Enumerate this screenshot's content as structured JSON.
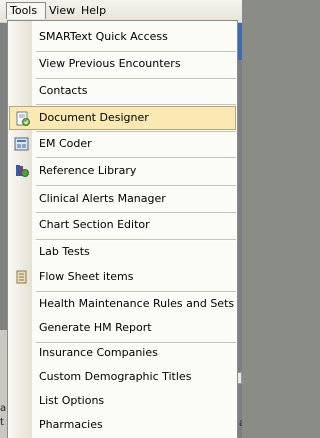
{
  "menubar": {
    "tools_label": "Tools",
    "view_label": "View",
    "help_label": "Help"
  },
  "background": {
    "left_text_1": "ab",
    "left_text_2": "t",
    "right_text": "a"
  },
  "tools_menu": {
    "items": [
      {
        "label": "SMARText Quick Access",
        "icon": ""
      },
      {
        "label": "View Previous Encounters",
        "icon": ""
      },
      {
        "label": "Contacts",
        "icon": ""
      },
      {
        "label": "Document Designer",
        "icon": "document-designer-icon",
        "highlighted": true
      },
      {
        "label": "EM Coder",
        "icon": "em-coder-icon"
      },
      {
        "label": "Reference Library",
        "icon": "reference-library-icon"
      },
      {
        "label": "Clinical Alerts Manager",
        "icon": ""
      },
      {
        "label": "Chart Section Editor",
        "icon": ""
      },
      {
        "label": "Lab Tests",
        "icon": ""
      },
      {
        "label": "Flow Sheet items",
        "icon": "flow-sheet-icon"
      },
      {
        "label": "Health Maintenance Rules and Sets",
        "icon": ""
      },
      {
        "label": "Generate HM Report",
        "icon": ""
      },
      {
        "label": "Insurance Companies",
        "icon": ""
      },
      {
        "label": "Custom Demographic Titles",
        "icon": ""
      },
      {
        "label": "List Options",
        "icon": ""
      },
      {
        "label": "Pharmacies",
        "icon": ""
      }
    ]
  },
  "colors": {
    "highlight_fill": "#fbe9b4",
    "highlight_border": "#b8a878",
    "menu_background": "#fbfbf8"
  }
}
